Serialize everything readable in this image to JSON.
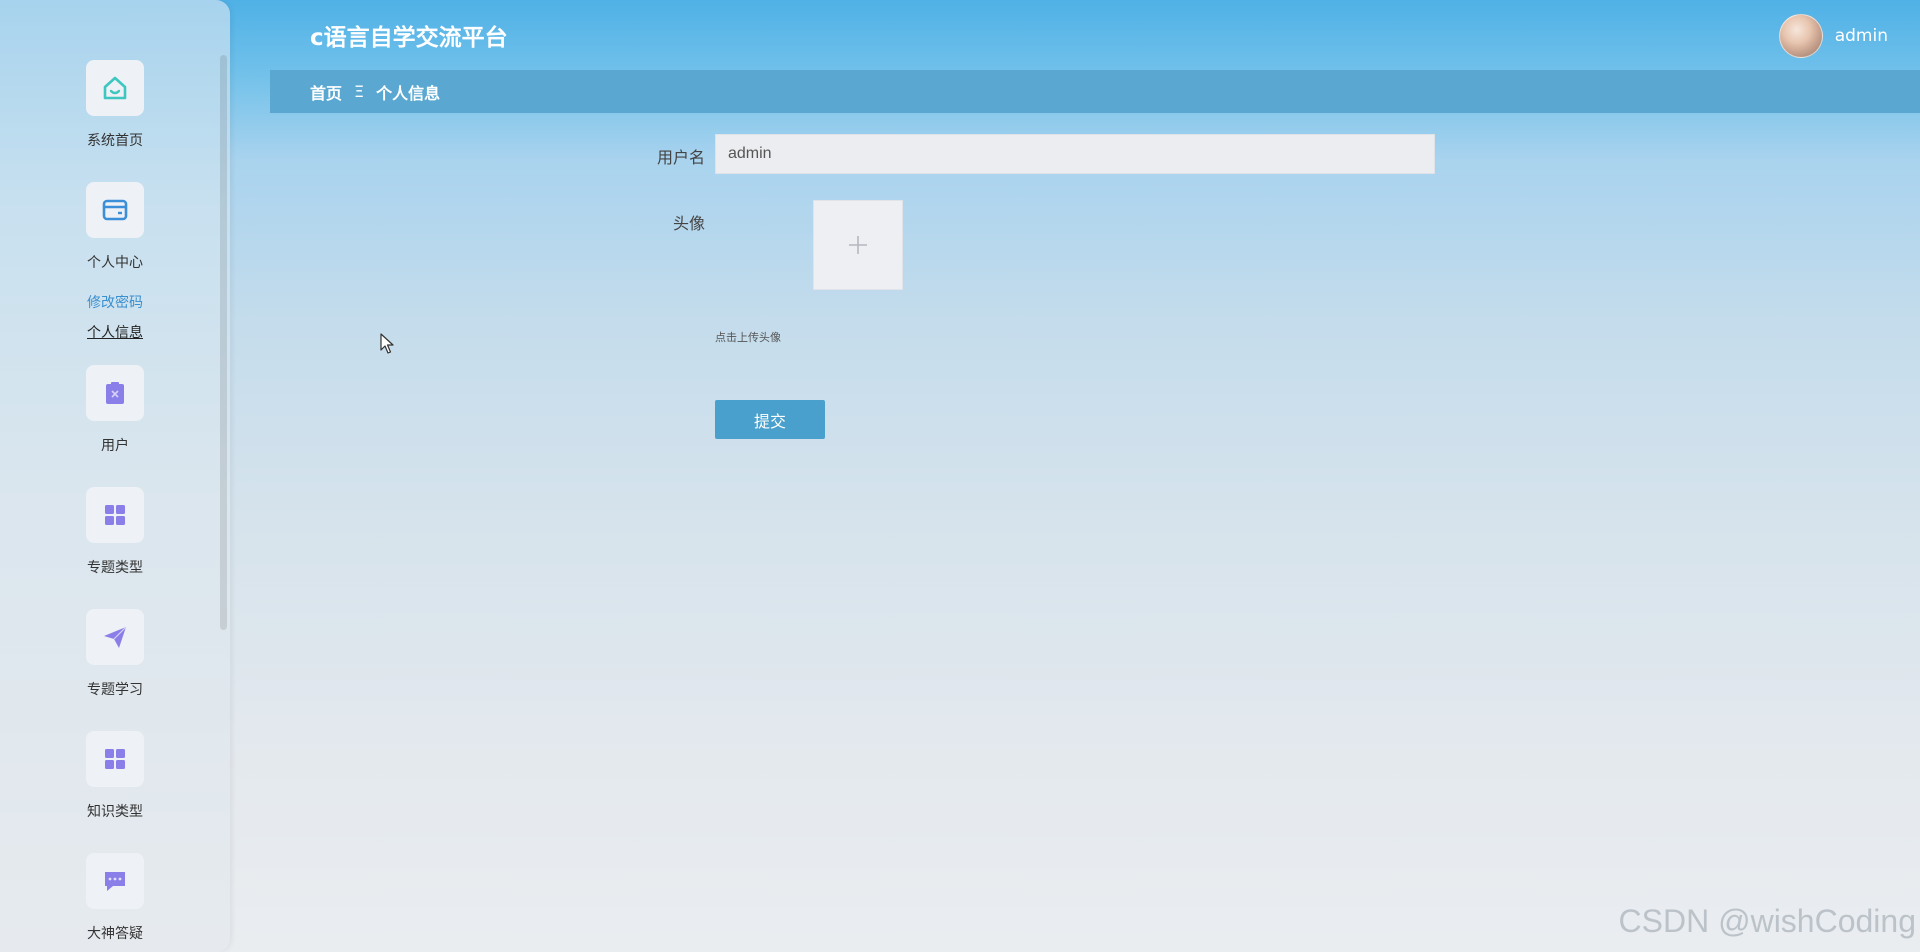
{
  "header": {
    "app_title": "c语言自学交流平台",
    "user_name": "admin"
  },
  "breadcrumb": {
    "home": "首页",
    "separator": "Ξ",
    "current": "个人信息"
  },
  "sidebar": {
    "items": [
      {
        "label": "系统首页",
        "icon": "home-icon",
        "color": "#3ec6c0"
      },
      {
        "label": "个人中心",
        "icon": "card-icon",
        "color": "#3a8fd8"
      },
      {
        "label": "用户",
        "icon": "clipboard-icon",
        "color": "#8a7ee8"
      },
      {
        "label": "专题类型",
        "icon": "grid-icon",
        "color": "#8a7ee8"
      },
      {
        "label": "专题学习",
        "icon": "paper-plane-icon",
        "color": "#8a7ee8"
      },
      {
        "label": "知识类型",
        "icon": "grid-icon",
        "color": "#8a7ee8"
      },
      {
        "label": "大神答疑",
        "icon": "chat-icon",
        "color": "#8a7ee8"
      }
    ],
    "sub_links": [
      {
        "label": "修改密码",
        "color": "#3a8fd0"
      },
      {
        "label": "个人信息",
        "color": "#222222"
      }
    ]
  },
  "form": {
    "username_label": "用户名",
    "username_value": "admin",
    "avatar_label": "头像",
    "upload_hint": "点击上传头像",
    "submit_label": "提交"
  },
  "watermark": "CSDN @wishCoding"
}
